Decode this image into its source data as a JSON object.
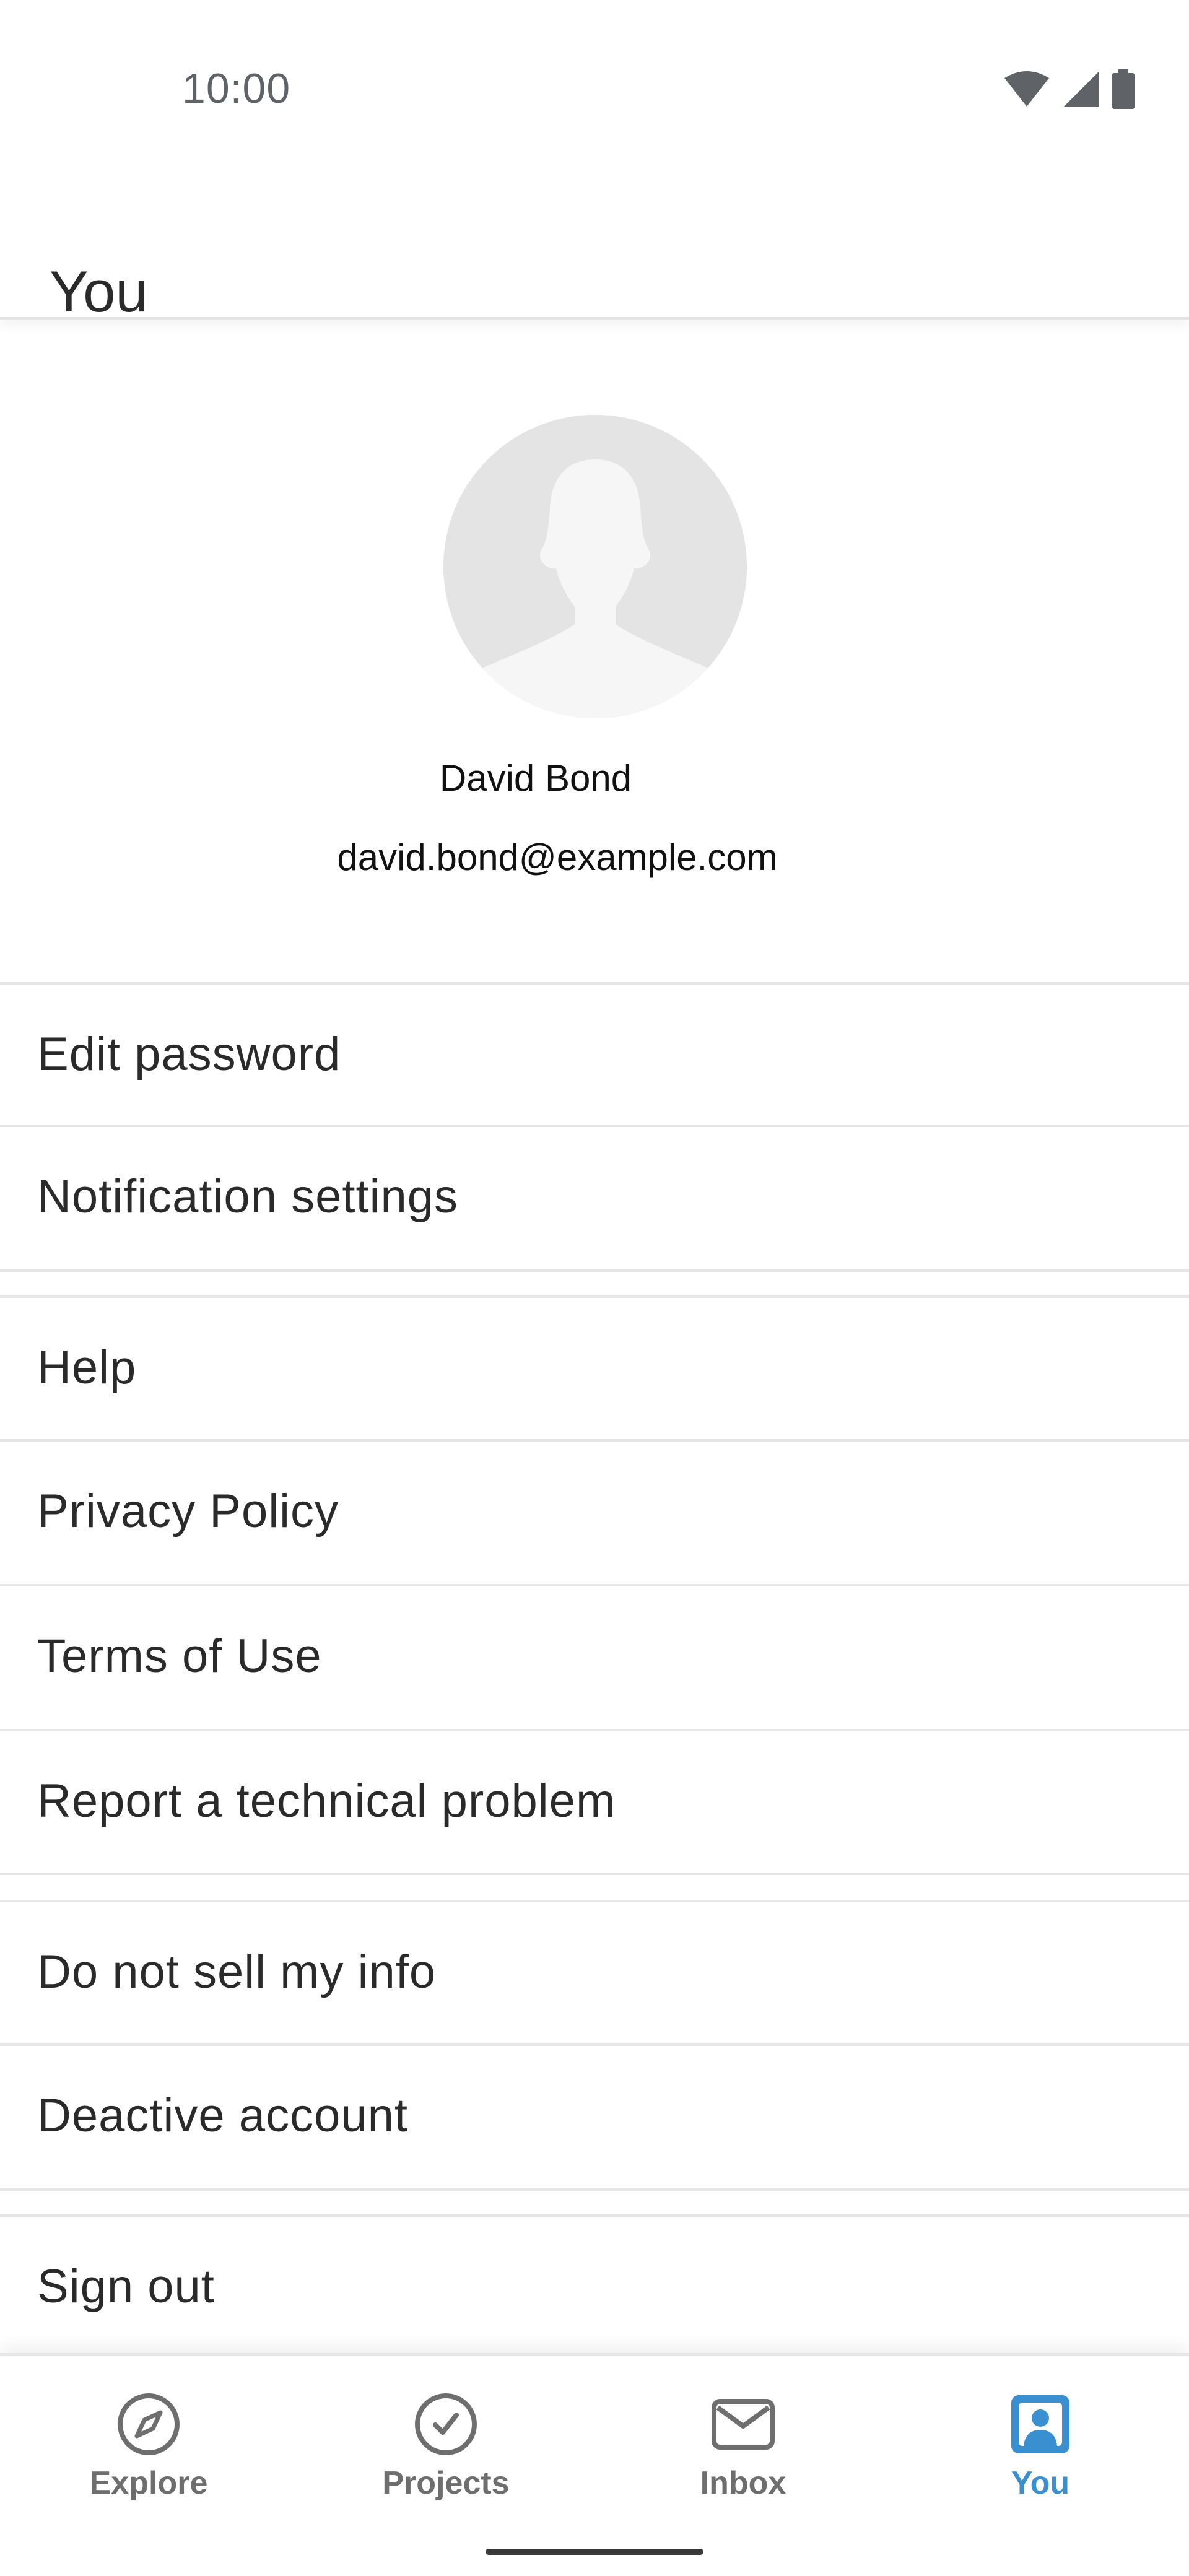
{
  "status_bar": {
    "time": "10:00",
    "icons": [
      "wifi-icon",
      "signal-icon",
      "battery-icon"
    ]
  },
  "app_bar": {
    "title": "You"
  },
  "profile": {
    "name": "David Bond",
    "email": "david.bond@example.com",
    "avatar_icon": "default-avatar-icon"
  },
  "menu": {
    "edit_password": "Edit password",
    "notification_settings": "Notification settings",
    "help": "Help",
    "privacy_policy": "Privacy Policy",
    "terms_of_use": "Terms of Use",
    "report_problem": "Report a technical problem",
    "do_not_sell": "Do not sell my info",
    "deactivate_account": "Deactive account",
    "sign_out": "Sign out"
  },
  "bottom_nav": {
    "items": [
      {
        "label": "Explore",
        "icon": "compass-icon",
        "active": false
      },
      {
        "label": "Projects",
        "icon": "check-circle-icon",
        "active": false
      },
      {
        "label": "Inbox",
        "icon": "envelope-icon",
        "active": false
      },
      {
        "label": "You",
        "icon": "profile-icon",
        "active": true
      }
    ]
  },
  "colors": {
    "accent": "#3a8fd0",
    "inactive": "#6e6e6e",
    "divider": "#e6e6e6"
  }
}
